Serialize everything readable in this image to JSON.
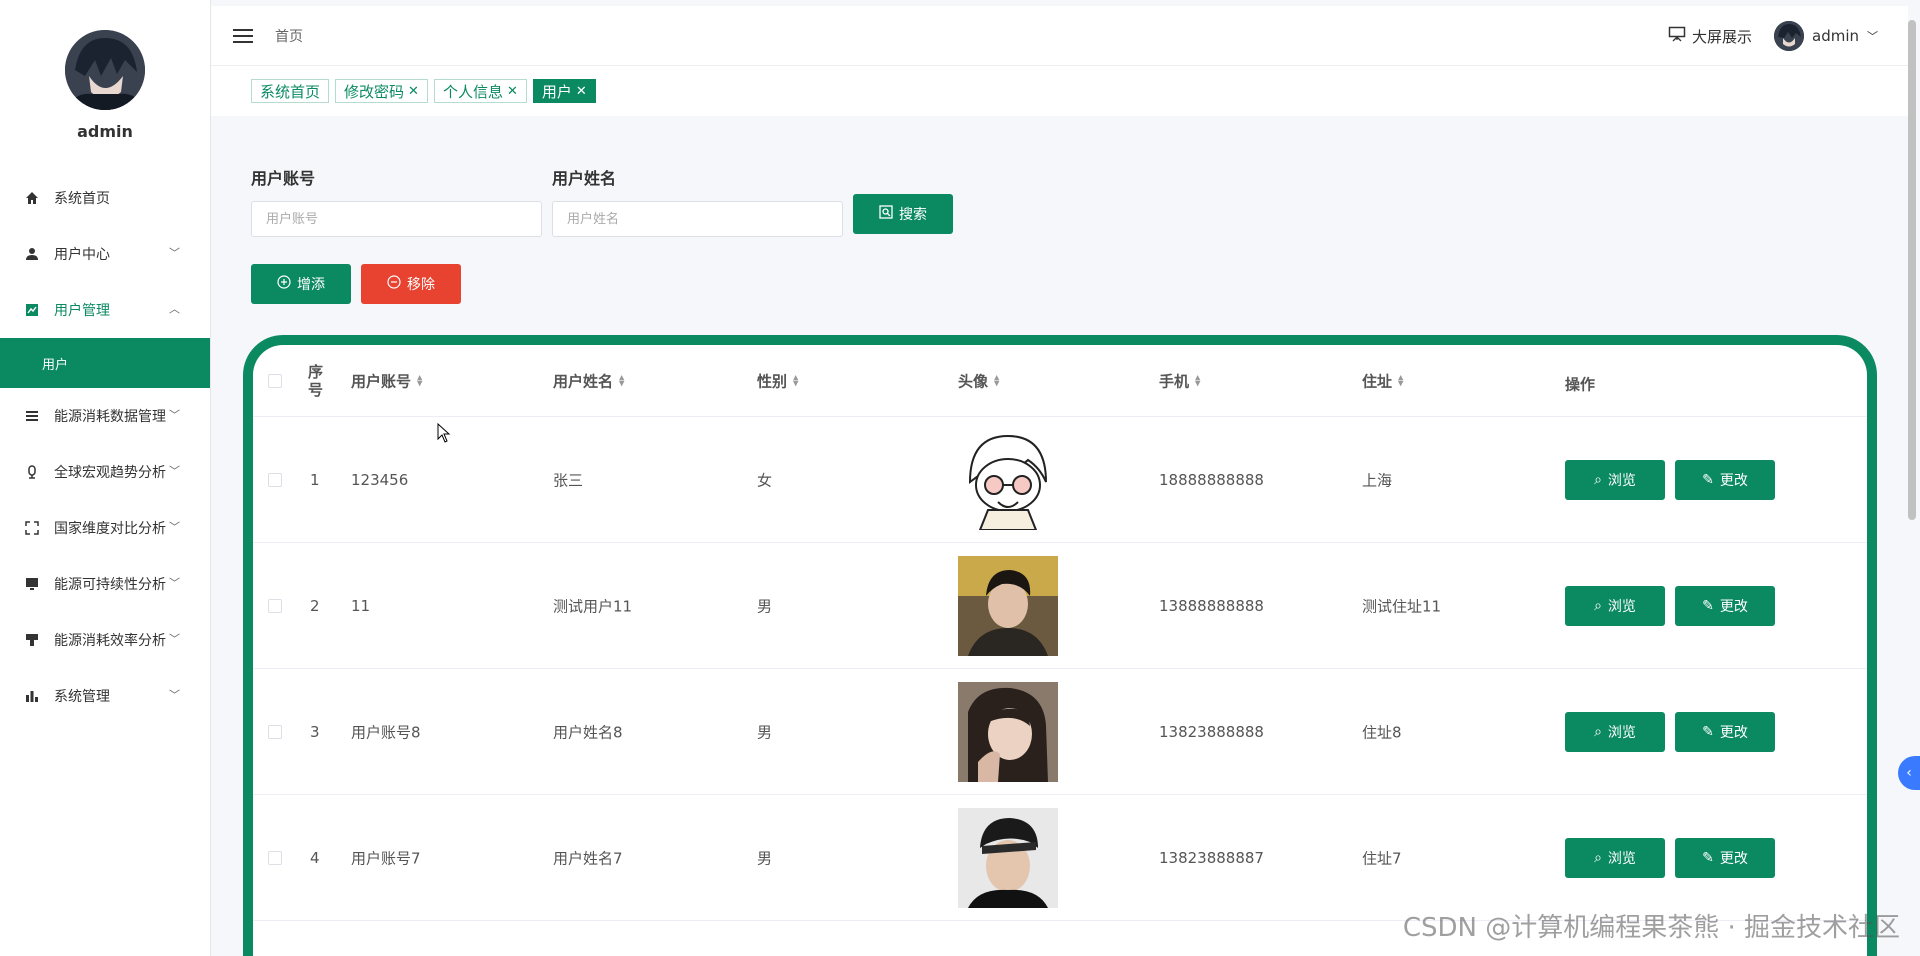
{
  "sidebar": {
    "username": "admin",
    "items": [
      {
        "label": "系统首页",
        "icon": "home-icon"
      },
      {
        "label": "用户中心",
        "icon": "user-icon"
      },
      {
        "label": "用户管理",
        "icon": "chart-icon"
      },
      {
        "label": "能源消耗数据管理",
        "icon": "list-icon"
      },
      {
        "label": "全球宏观趋势分析",
        "icon": "mic-icon"
      },
      {
        "label": "国家维度对比分析",
        "icon": "fullscreen-icon"
      },
      {
        "label": "能源可持续性分析",
        "icon": "monitor-icon"
      },
      {
        "label": "能源消耗效率分析",
        "icon": "brush-icon"
      },
      {
        "label": "系统管理",
        "icon": "bar-chart-icon"
      }
    ],
    "submenu_active": "用户"
  },
  "topbar": {
    "breadcrumb": "首页",
    "bigscreen_label": "大屏展示",
    "user_label": "admin"
  },
  "tags": [
    {
      "label": "系统首页",
      "closable": false
    },
    {
      "label": "修改密码",
      "closable": true
    },
    {
      "label": "个人信息",
      "closable": true
    },
    {
      "label": "用户",
      "closable": true
    }
  ],
  "search": {
    "account_label": "用户账号",
    "account_placeholder": "用户账号",
    "name_label": "用户姓名",
    "name_placeholder": "用户姓名",
    "search_button": "搜索"
  },
  "actions": {
    "add_button": "增添",
    "delete_button": "移除"
  },
  "table": {
    "headers": {
      "index": "序号",
      "account": "用户账号",
      "name": "用户姓名",
      "gender": "性别",
      "avatar": "头像",
      "phone": "手机",
      "address": "住址",
      "ops": "操作"
    },
    "view_label": "浏览",
    "edit_label": "更改",
    "rows": [
      {
        "index": "1",
        "account": "123456",
        "name": "张三",
        "gender": "女",
        "phone": "18888888888",
        "address": "上海"
      },
      {
        "index": "2",
        "account": "11",
        "name": "测试用户11",
        "gender": "男",
        "phone": "13888888888",
        "address": "测试住址11"
      },
      {
        "index": "3",
        "account": "用户账号8",
        "name": "用户姓名8",
        "gender": "男",
        "phone": "13823888888",
        "address": "住址8"
      },
      {
        "index": "4",
        "account": "用户账号7",
        "name": "用户姓名7",
        "gender": "男",
        "phone": "13823888887",
        "address": "住址7"
      }
    ]
  },
  "watermark": "CSDN @计算机编程果茶熊 · 掘金技术社区",
  "colors": {
    "primary": "#0b8a62",
    "danger": "#e84330"
  }
}
